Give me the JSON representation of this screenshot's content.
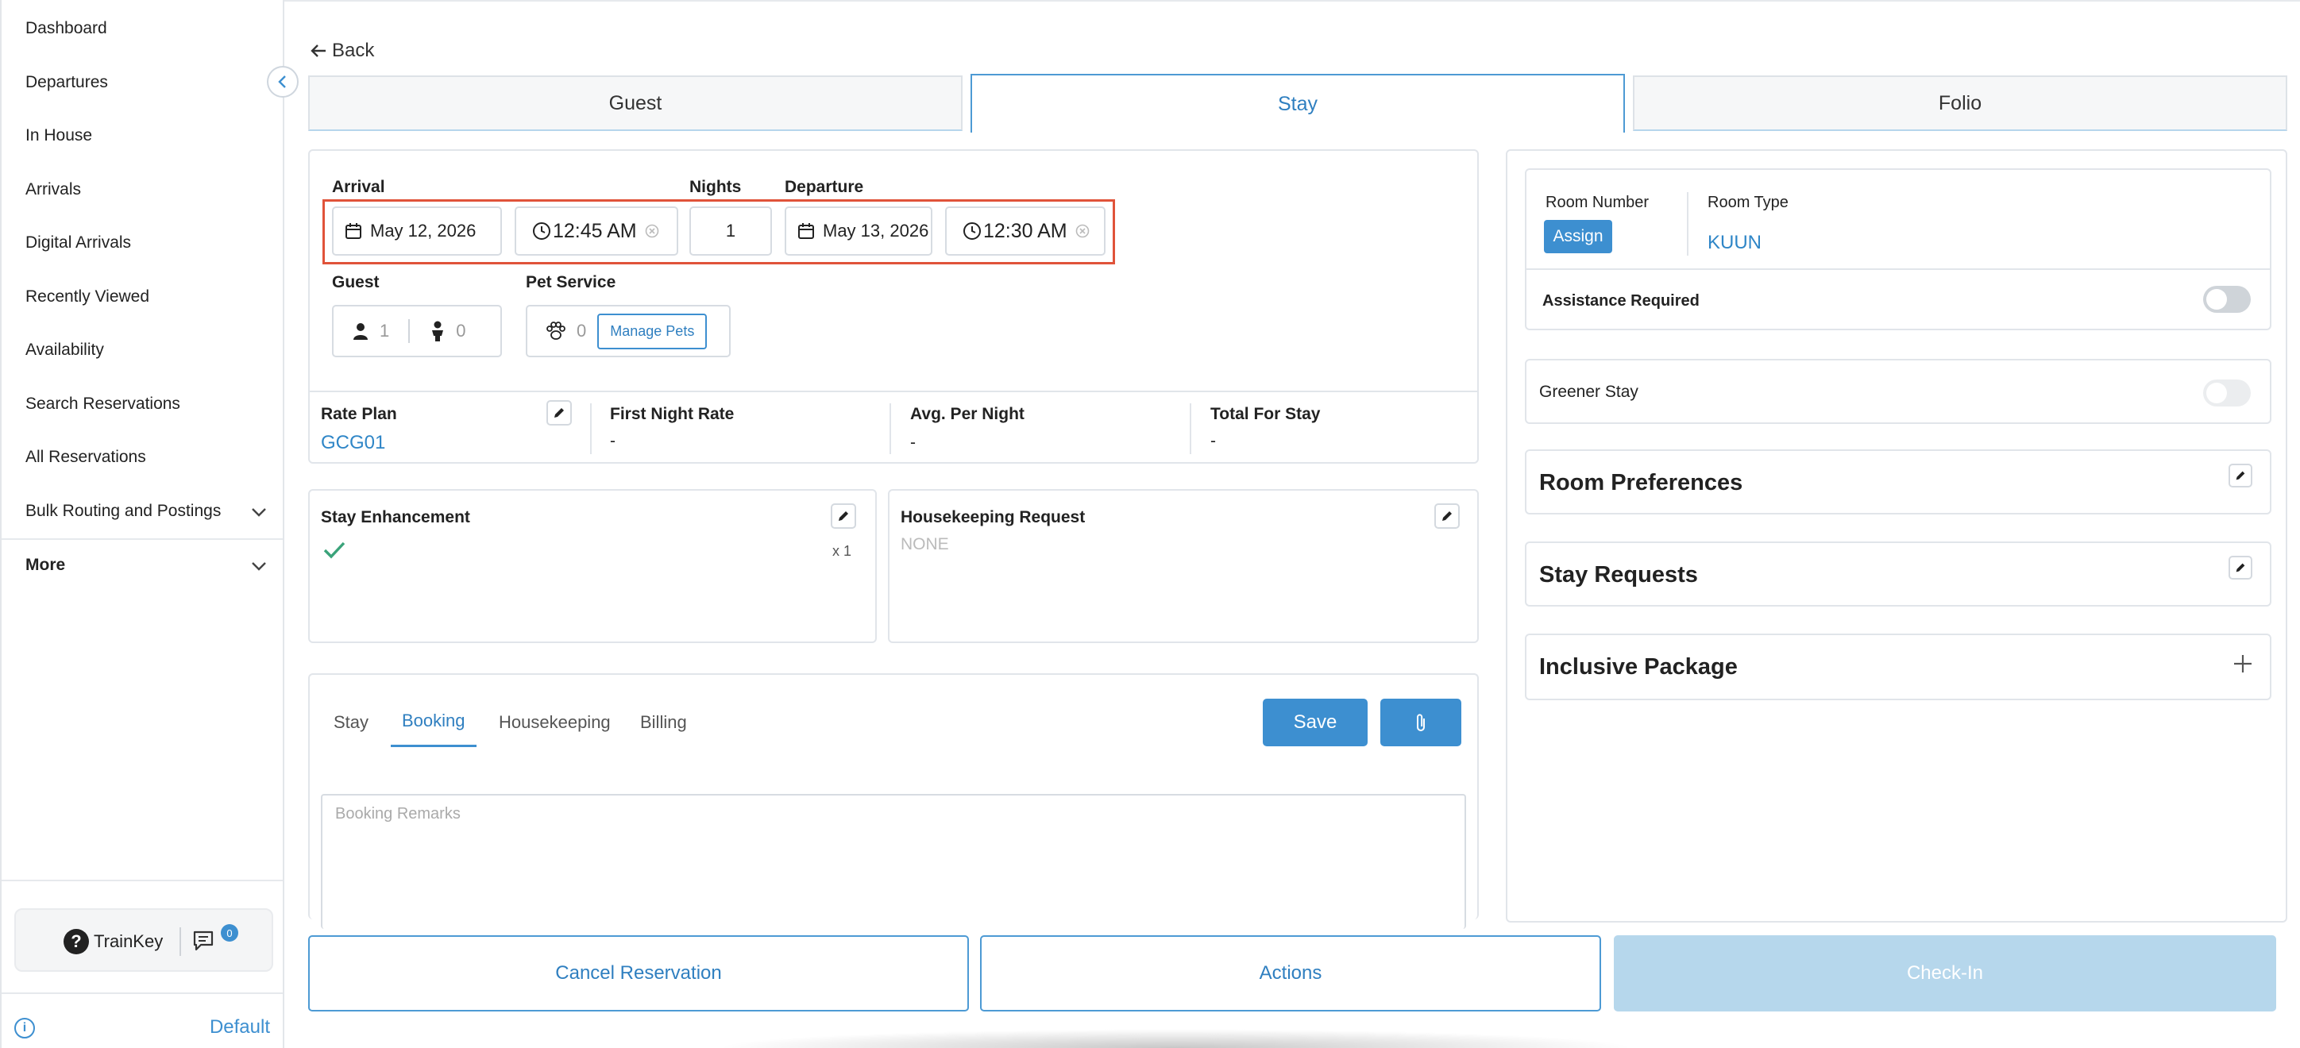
{
  "sidebar": {
    "items": [
      {
        "label": "Dashboard"
      },
      {
        "label": "Departures"
      },
      {
        "label": "In House"
      },
      {
        "label": "Arrivals"
      },
      {
        "label": "Digital Arrivals"
      },
      {
        "label": "Recently Viewed"
      },
      {
        "label": "Availability"
      },
      {
        "label": "Search Reservations"
      },
      {
        "label": "All Reservations"
      },
      {
        "label": "Bulk Routing and Postings"
      },
      {
        "label": "More"
      }
    ],
    "trainkey_label": "TrainKey",
    "chat_count": "0",
    "footer_link": "Default"
  },
  "back_label": "Back",
  "tabs": [
    {
      "label": "Guest"
    },
    {
      "label": "Stay"
    },
    {
      "label": "Folio"
    }
  ],
  "stay": {
    "arrival_label": "Arrival",
    "arrival_date": "May 12, 2026",
    "arrival_time": "12:45 AM",
    "nights_label": "Nights",
    "nights_value": "1",
    "departure_label": "Departure",
    "departure_date": "May 13, 2026",
    "departure_time": "12:30 AM",
    "guest_label": "Guest",
    "adults": "1",
    "children": "0",
    "pet_label": "Pet Service",
    "pets": "0",
    "manage_pets": "Manage Pets"
  },
  "rates": {
    "rate_plan_label": "Rate Plan",
    "rate_plan_value": "GCG01",
    "first_night_label": "First Night Rate",
    "first_night_value": "-",
    "avg_label": "Avg. Per Night",
    "avg_value": "-",
    "total_label": "Total For Stay",
    "total_value": "-"
  },
  "enhancement": {
    "title": "Stay Enhancement",
    "qty": "x 1"
  },
  "housekeeping": {
    "title": "Housekeeping Request",
    "value": "NONE"
  },
  "remarks": {
    "tabs": [
      "Stay",
      "Booking",
      "Housekeeping",
      "Billing"
    ],
    "active_tab": "Booking",
    "save_label": "Save",
    "placeholder": "Booking Remarks"
  },
  "room": {
    "room_number_label": "Room Number",
    "assign_label": "Assign",
    "room_type_label": "Room Type",
    "room_type_value": "KUUN",
    "assistance_label": "Assistance Required",
    "greener_label": "Greener Stay",
    "room_prefs": "Room Preferences",
    "stay_requests": "Stay Requests",
    "inclusive_package": "Inclusive Package"
  },
  "actions": {
    "cancel": "Cancel Reservation",
    "actions": "Actions",
    "checkin": "Check-In"
  },
  "colors": {
    "accent": "#3d8fd0",
    "highlight": "#e0533a",
    "checkin_disabled": "#b6d7ec"
  }
}
